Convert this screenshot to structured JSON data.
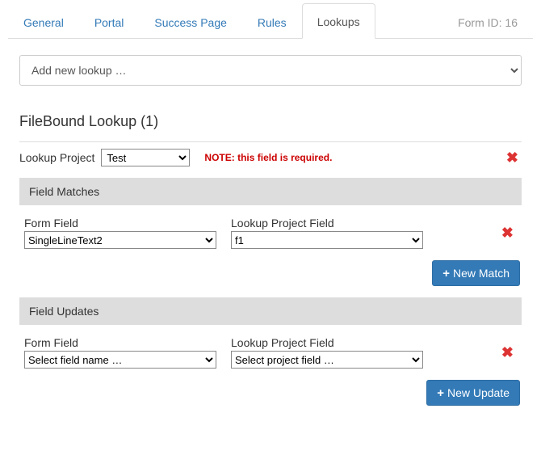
{
  "tabs": {
    "general": "General",
    "portal": "Portal",
    "success": "Success Page",
    "rules": "Rules",
    "lookups": "Lookups",
    "form_id": "Form ID: 16"
  },
  "add_lookup_placeholder": "Add new lookup …",
  "section_title": "FileBound Lookup (1)",
  "lookup_project": {
    "label": "Lookup Project",
    "value": "Test",
    "note": "NOTE: this field is required."
  },
  "matches": {
    "header": "Field Matches",
    "form_field_label": "Form Field",
    "project_field_label": "Lookup Project Field",
    "row": {
      "form_field": "SingleLineText2",
      "project_field": "f1"
    },
    "button": "New Match"
  },
  "updates": {
    "header": "Field Updates",
    "form_field_label": "Form Field",
    "project_field_label": "Lookup Project Field",
    "row": {
      "form_field": "Select field name …",
      "project_field": "Select project field …"
    },
    "button": "New Update"
  }
}
